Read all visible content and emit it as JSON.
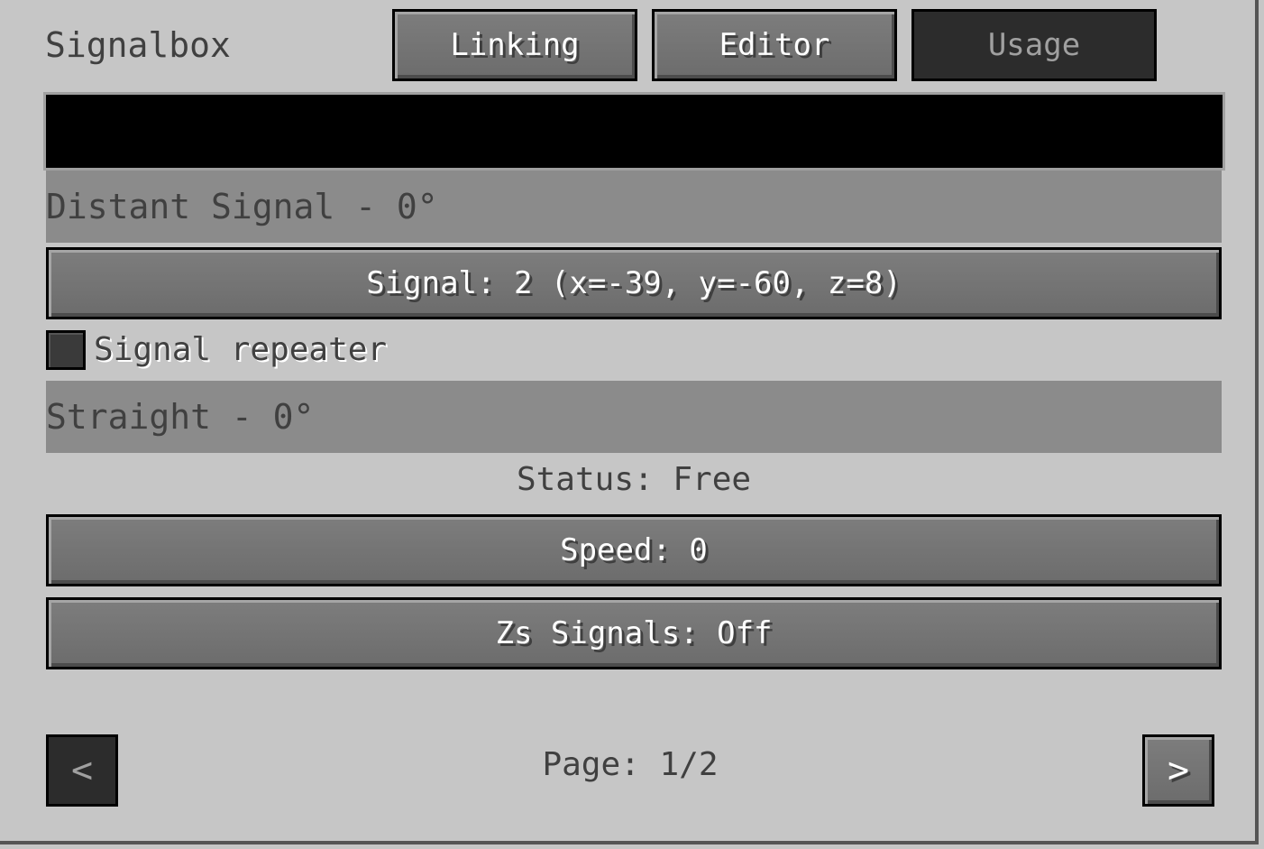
{
  "window": {
    "title": "Signalbox"
  },
  "tabs": {
    "linking": "Linking",
    "editor": "Editor",
    "usage": "Usage",
    "active": "usage"
  },
  "main": {
    "name_field_value": "",
    "distant_label": "Distant Signal - 0°",
    "signal_button": "Signal: 2 (x=-39, y=-60, z=8)",
    "repeater_label": "Signal repeater",
    "repeater_checked": false,
    "straight_label": "Straight - 0°",
    "status_text": "Status: Free",
    "speed_button": "Speed: 0",
    "zs_button": "Zs Signals: Off"
  },
  "pagination": {
    "page_label": "Page: 1/2",
    "prev_icon": "<",
    "next_icon": ">"
  },
  "colors": {
    "background": "#c6c6c6",
    "button": "#6f6f6f",
    "button_disabled": "#2c2c2c",
    "info_bar": "#8b8b8b",
    "text": "#404040"
  }
}
